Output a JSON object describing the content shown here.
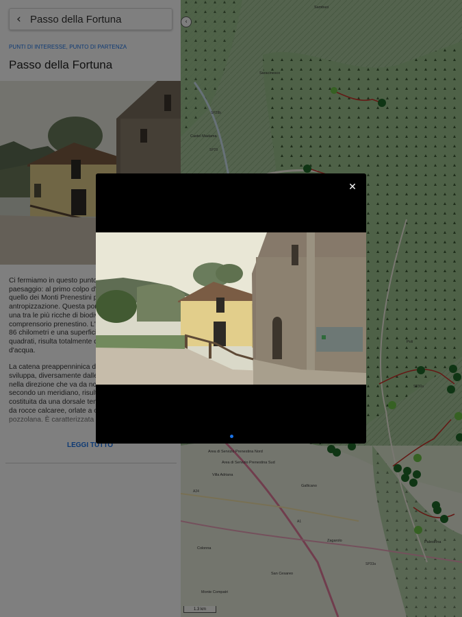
{
  "panel": {
    "back_title": "Passo della Fortuna",
    "category": "PUNTI DI INTERESSE, PUNTO DI PARTENZA",
    "place_title": "Passo della Fortuna",
    "description": [
      "Ci fermiamo in questo punto per ammirare il paesaggio: al primo colpo d'occhio su un territorio quello dei Monti Prenestini praticamente privo di antropizzazione. Questa porzione di territorio si rivela una tra le più ricche di biodiversità dell'intero comprensorio prenestino. L'area, con un perimetro di 86 chilometri e una superficie di circa 221 chilometri quadrati, risulta totalmente delimitata da corsi d'acqua.",
      "La catena preappenninica dei Monti Prenestini si sviluppa, diversamente dalle altre catene (NW-SE), nella direzione che va da nord a sud ed è allineata secondo un meridiano, risultando sostanzialmente costituita da una dorsale tendente a est. È formata da rocce calcaree, orlate a ovest e a sud da pozzolana. È caratterizzata da"
    ],
    "read_more": "LEGGI TUTTO"
  },
  "map": {
    "scale": "1.3 km",
    "labels": [
      "Sambuci",
      "Saracinesco",
      "Palombara Sabina",
      "Castel Madama",
      "Tivoli",
      "Gallicano",
      "Zagarolo",
      "Poli",
      "Palestrina",
      "San Cesareo",
      "Monte Compatri",
      "Guadagnolo",
      "Pisoniano",
      "San Vito Romano",
      "Area di Servizio Prenestina Nord",
      "Area di Servizio Prenestina Sud",
      "Villa Adriana",
      "Colonna"
    ],
    "roads": [
      "SP28b",
      "SP29",
      "SP30a",
      "SP33a",
      "A1",
      "A24",
      "SR155",
      "SS6",
      "SP62a",
      "SP57a"
    ]
  },
  "modal": {
    "close_icon": "close-icon",
    "slide_count": 1,
    "active_slide": 1
  },
  "colors": {
    "accent": "#1a73e8",
    "trail": "#c8322a",
    "poi_dark": "#1e6b28",
    "poi_light": "#6cc246"
  }
}
